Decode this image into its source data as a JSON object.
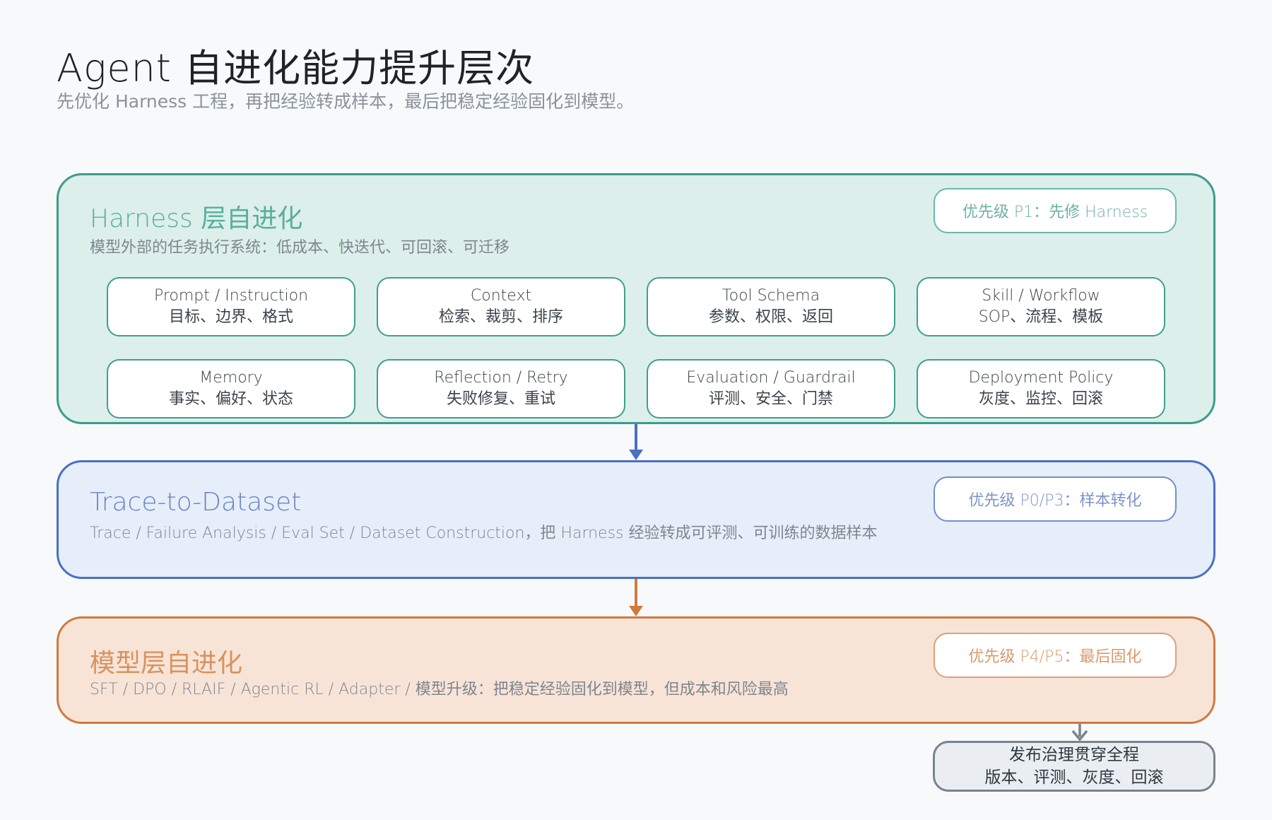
{
  "header": {
    "title": "Agent 自进化能力提升层次",
    "subtitle": "先优化 Harness 工程，再把经验转成样本，最后把稳定经验固化到模型。"
  },
  "layers": [
    {
      "id": "harness",
      "title": "Harness 层自进化",
      "description": "模型外部的任务执行系统：低成本、快迭代、可回滚、可迁移",
      "priority": "优先级 P1：先修 Harness",
      "color": "#3c9c8b",
      "modules": [
        {
          "title": "Prompt / Instruction",
          "detail": "目标、边界、格式"
        },
        {
          "title": "Context",
          "detail": "检索、裁剪、排序"
        },
        {
          "title": "Tool Schema",
          "detail": "参数、权限、返回"
        },
        {
          "title": "Skill / Workflow",
          "detail": "SOP、流程、模板"
        },
        {
          "title": "Memory",
          "detail": "事实、偏好、状态"
        },
        {
          "title": "Reflection / Retry",
          "detail": "失败修复、重试"
        },
        {
          "title": "Evaluation / Guardrail",
          "detail": "评测、安全、门禁"
        },
        {
          "title": "Deployment Policy",
          "detail": "灰度、监控、回滚"
        }
      ]
    },
    {
      "id": "trace",
      "title": "Trace-to-Dataset",
      "description": "Trace / Failure Analysis / Eval Set / Dataset Construction，把 Harness 经验转成可评测、可训练的数据样本",
      "priority": "优先级 P0/P3：样本转化",
      "color": "#4a6fc4"
    },
    {
      "id": "model",
      "title": "模型层自进化",
      "description": "SFT / DPO / RLAIF / Agentic RL / Adapter / 模型升级：把稳定经验固化到模型，但成本和风险最高",
      "priority": "优先级 P4/P5：最后固化",
      "color": "#d07a3f"
    }
  ],
  "governance": {
    "title": "发布治理贯穿全程",
    "detail": "版本、评测、灰度、回滚",
    "color": "#79838d"
  }
}
